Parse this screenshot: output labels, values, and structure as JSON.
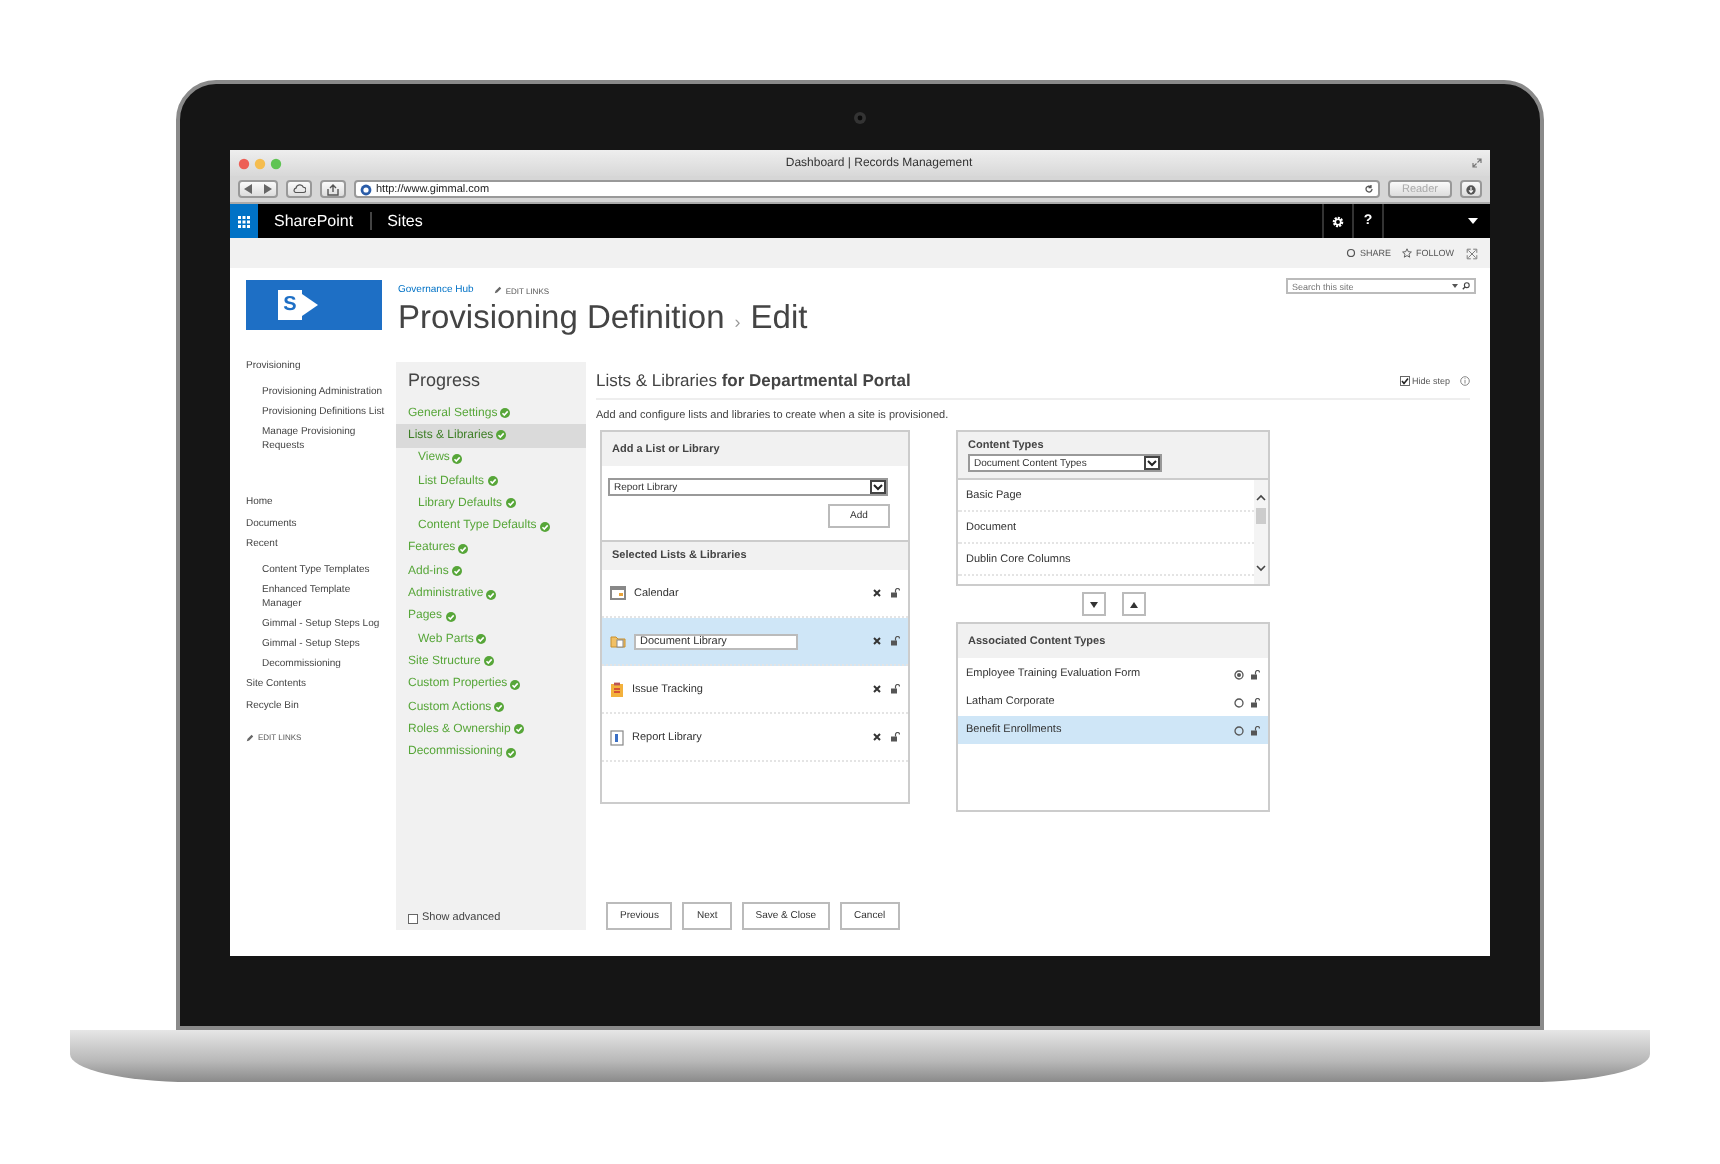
{
  "browser": {
    "title": "Dashboard | Records Management",
    "url": "http://www.gimmal.com",
    "reader_button": "Reader"
  },
  "suite_bar": {
    "app_name": "SharePoint",
    "links": [
      "Sites"
    ],
    "help": "?"
  },
  "actions": [
    "SHARE",
    "FOLLOW"
  ],
  "header": {
    "logo_letter": "S",
    "site_link": "Governance Hub",
    "edit_links": "EDIT LINKS",
    "title": "Provisioning Definition",
    "separator": "›",
    "subtitle": "Edit",
    "search_placeholder": "Search this site"
  },
  "quick_launch": {
    "items": [
      {
        "label": "Provisioning",
        "children": [
          {
            "label": "Provisioning Administration"
          },
          {
            "label": "Provisioning Definitions List"
          },
          {
            "label": "Manage Provisioning Requests"
          }
        ]
      },
      {
        "label": "Home"
      },
      {
        "label": "Documents"
      },
      {
        "label": "Recent",
        "children": [
          {
            "label": "Content Type Templates"
          },
          {
            "label": "Enhanced Template Manager"
          },
          {
            "label": "Gimmal - Setup Steps Log"
          },
          {
            "label": "Gimmal - Setup Steps"
          },
          {
            "label": "Decommissioning"
          }
        ]
      },
      {
        "label": "Site Contents"
      },
      {
        "label": "Recycle Bin"
      }
    ],
    "edit_links": "EDIT LINKS"
  },
  "progress": {
    "title": "Progress",
    "steps": [
      {
        "label": "General Settings",
        "done": true,
        "selected": false
      },
      {
        "label": "Lists & Libraries",
        "done": true,
        "selected": true,
        "children": [
          {
            "label": "Views",
            "done": true,
            "selected": false
          },
          {
            "label": "List Defaults",
            "done": true,
            "selected": false
          },
          {
            "label": "Library Defaults",
            "done": true,
            "selected": false
          },
          {
            "label": "Content Type Defaults",
            "done": true,
            "selected": false
          }
        ]
      },
      {
        "label": "Features",
        "done": true,
        "selected": false
      },
      {
        "label": "Add-ins",
        "done": true,
        "selected": false
      },
      {
        "label": "Administrative",
        "done": true,
        "selected": false
      },
      {
        "label": "Pages",
        "done": true,
        "selected": false,
        "children": [
          {
            "label": "Web Parts",
            "done": true,
            "selected": false
          }
        ]
      },
      {
        "label": "Site Structure",
        "done": true,
        "selected": false
      },
      {
        "label": "Custom Properties",
        "done": true,
        "selected": false
      },
      {
        "label": "Custom Actions",
        "done": true,
        "selected": false
      },
      {
        "label": "Roles & Ownership",
        "done": true,
        "selected": false
      },
      {
        "label": "Decommissioning",
        "done": true,
        "selected": false
      }
    ],
    "show_advanced": {
      "label": "Show advanced",
      "checked": false
    }
  },
  "main": {
    "heading": "Lists & Libraries **for Departmental Portal**",
    "hide_step": {
      "label": "Hide step",
      "checked": true
    },
    "description": "Add and configure lists and libraries to create when a site is provisioned.",
    "add_panel": {
      "title": "Add a List or Library",
      "select_value": "Report Library",
      "button": "Add"
    },
    "selected_lists": {
      "title": "Selected Lists & Libraries",
      "items": [
        {
          "label": "Calendar",
          "kind": "calendar",
          "selected": false,
          "editing": false
        },
        {
          "label": "Document Library",
          "kind": "document-library",
          "selected": true,
          "editing": true
        },
        {
          "label": "Issue Tracking",
          "kind": "issue-tracking",
          "selected": false,
          "editing": false
        },
        {
          "label": "Report Library",
          "kind": "report-library",
          "selected": false,
          "editing": false
        }
      ]
    },
    "content_types": {
      "title": "Content Types",
      "select_value": "Document Content Types",
      "items": [
        {
          "label": "Basic Page",
          "selected": false
        },
        {
          "label": "Document",
          "selected": false
        },
        {
          "label": "Dublin Core Columns",
          "selected": false
        }
      ]
    },
    "associated": {
      "title": "Associated Content Types",
      "items": [
        {
          "label": "Employee Training Evaluation Form",
          "default": true,
          "selected": false
        },
        {
          "label": "Latham Corporate",
          "default": false,
          "selected": false
        },
        {
          "label": "Benefit Enrollments",
          "default": false,
          "selected": true
        }
      ]
    },
    "buttons": [
      "Previous",
      "Next",
      "Save & Close",
      "Cancel"
    ]
  }
}
